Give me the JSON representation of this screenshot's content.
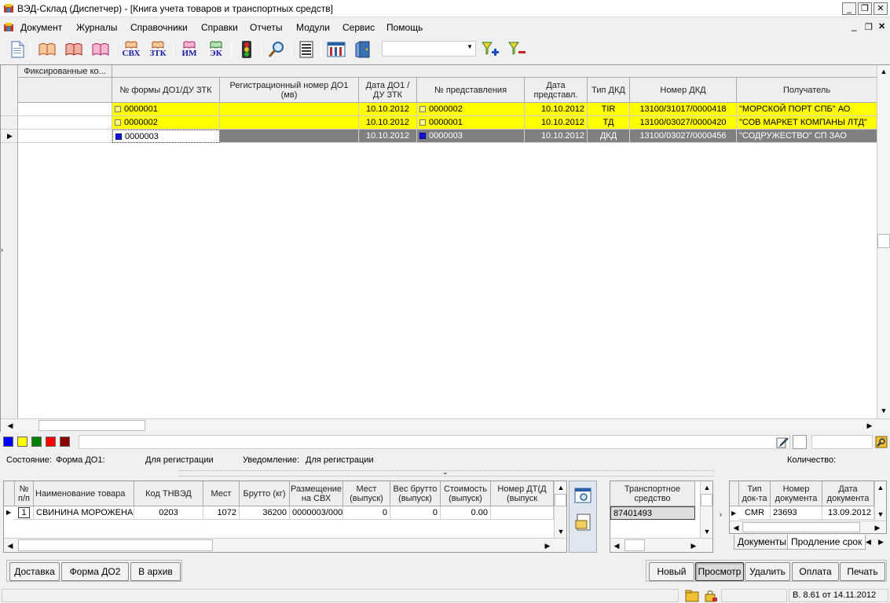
{
  "window": {
    "title": "ВЭД-Склад (Диспетчер) - [Книга учета товаров и транспортных средств]",
    "min_glyph": "_",
    "restore_glyph": "❐",
    "close_glyph": "✕"
  },
  "menu": {
    "items": [
      "Документ",
      "Журналы",
      "Справочники",
      "Справки",
      "Отчеты",
      "Модули",
      "Сервис",
      "Помощь"
    ]
  },
  "toolbar": {
    "svx": "СВХ",
    "ztk": "ЗТК",
    "im": "ИМ",
    "ek": "ЭК",
    "filter_value": ""
  },
  "top_grid": {
    "fixed_header": "Фиксированные ко...",
    "columns": [
      "№ формы ДО1/ДУ ЗТК",
      "Регистрационный номер ДО1 (мв)",
      "Дата ДО1 / ДУ ЗТК",
      "№ представления",
      "Дата представл.",
      "Тип ДКД",
      "Номер ДКД",
      "Получатель"
    ],
    "rows": [
      {
        "form_no": "0000001",
        "reg_no": "",
        "date": "10.10.2012",
        "present_no": "0000002",
        "present_date": "10.10.2012",
        "dkd_type": "TIR",
        "dkd_no": "13100/31017/0000418",
        "recipient": "\"МОРСКОЙ ПОРТ СПБ\" АО"
      },
      {
        "form_no": "0000002",
        "reg_no": "",
        "date": "10.10.2012",
        "present_no": "0000001",
        "present_date": "10.10.2012",
        "dkd_type": "ТД",
        "dkd_no": "13100/03027/0000420",
        "recipient": "\"СОВ МАРКЕТ КОМПАНЫ ЛТД\""
      },
      {
        "form_no": "0000003",
        "reg_no": "",
        "date": "10.10.2012",
        "present_no": "0000003",
        "present_date": "10.10.2012",
        "dkd_type": "ДКД",
        "dkd_no": "13100/03027/0000456",
        "recipient": "\"СОДРУЖЕСТВО\" СП ЗАО"
      }
    ]
  },
  "colors": {
    "row_highlight": "#ffff00",
    "row_selected": "#808080",
    "swatches": [
      "#0000ff",
      "#ffff00",
      "#008000",
      "#ff0000",
      "#8b0000"
    ]
  },
  "status": {
    "state_label": "Состояние:",
    "form_label": "Форма ДО1:",
    "form_value": "Для регистрации",
    "notice_label": "Уведомление:",
    "notice_value": "Для регистрации",
    "qty_label": "Количество:"
  },
  "goods_grid": {
    "columns": [
      "№ п/п",
      "Наименование товара",
      "Код ТНВЭД",
      "Мест",
      "Брутто (кг)",
      "Размещение на СВХ",
      "Мест (выпуск)",
      "Вес брутто (выпуск)",
      "Стоимость (выпуск)",
      "Номер ДТ(Д (выпуск"
    ],
    "row": {
      "num": "1",
      "name": "СВИНИНА МОРОЖЕНАЯ",
      "code": "0203",
      "places": "1072",
      "gross": "36200",
      "placement": "0000003/000",
      "places_out": "0",
      "gross_out": "0",
      "cost_out": "0.00",
      "dt_no": ""
    }
  },
  "transport": {
    "header": "Транспортное средство",
    "value": "87401493"
  },
  "docs_grid": {
    "columns": [
      "Тип док-та",
      "Номер документа",
      "Дата документа"
    ],
    "row": {
      "type": "CMR",
      "number": "23693",
      "date": "13.09.2012"
    },
    "tabs": [
      "Документы",
      "Продление срок"
    ]
  },
  "buttons_left": [
    "Доставка",
    "Форма ДО2",
    "В архив"
  ],
  "buttons_right": [
    "Новый",
    "Просмотр",
    "Удалить",
    "Оплата",
    "Печать"
  ],
  "statusbar": {
    "version": "В. 8.61 от 14.11.2012"
  }
}
